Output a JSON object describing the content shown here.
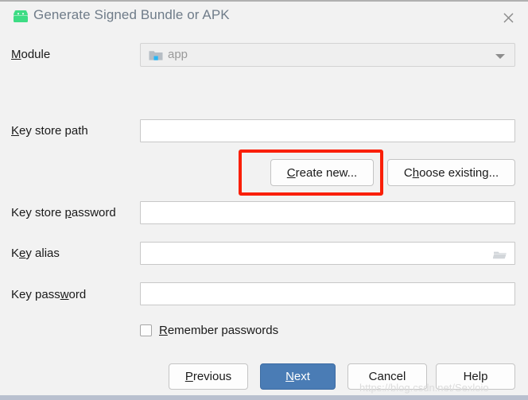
{
  "window": {
    "title": "Generate Signed Bundle or APK",
    "app_icon": "android-robot-icon",
    "close_icon": "close-icon"
  },
  "form": {
    "module": {
      "label_pre": "",
      "label_mnemonic": "M",
      "label_post": "odule",
      "value": "app",
      "icon": "module-folder-icon",
      "dropdown_icon": "chevron-down-icon"
    },
    "key_store_path": {
      "label_mnemonic": "K",
      "label_post": "ey store path",
      "value": "",
      "placeholder": ""
    },
    "key_store_password": {
      "label_pre": "Key store ",
      "label_mnemonic": "p",
      "label_post": "assword",
      "value": "",
      "placeholder": ""
    },
    "key_alias": {
      "label_pre": "K",
      "label_mnemonic": "e",
      "label_post": "y alias",
      "value": "",
      "placeholder": "",
      "browse_icon": "folder-browse-icon"
    },
    "key_password": {
      "label_pre": "Key pass",
      "label_mnemonic": "w",
      "label_post": "ord",
      "value": "",
      "placeholder": ""
    },
    "remember_passwords": {
      "label_mnemonic": "R",
      "label_post": "emember passwords",
      "checked": false
    }
  },
  "buttons": {
    "create_new": {
      "pre": "",
      "mnemonic": "C",
      "post": "reate new..."
    },
    "choose_existing": {
      "pre": "C",
      "mnemonic": "h",
      "post": "oose existing..."
    },
    "previous": {
      "pre": "",
      "mnemonic": "P",
      "post": "revious"
    },
    "next": {
      "pre": "",
      "mnemonic": "N",
      "post": "ext"
    },
    "cancel": {
      "pre": "Cancel",
      "mnemonic": "",
      "post": ""
    },
    "help": {
      "pre": "Help",
      "mnemonic": "",
      "post": ""
    }
  },
  "annotation": {
    "highlight_color": "#fa1f07",
    "target": "create-new-button"
  },
  "watermark": {
    "text": "https://blog.csdn.net/Sexloio"
  },
  "colors": {
    "background": "#f2f2f2",
    "primary_button": "#4a7cb5",
    "title_text": "#6f7c89",
    "android_green": "#3ddc84",
    "bottom_strip": "#b9c0cf"
  }
}
